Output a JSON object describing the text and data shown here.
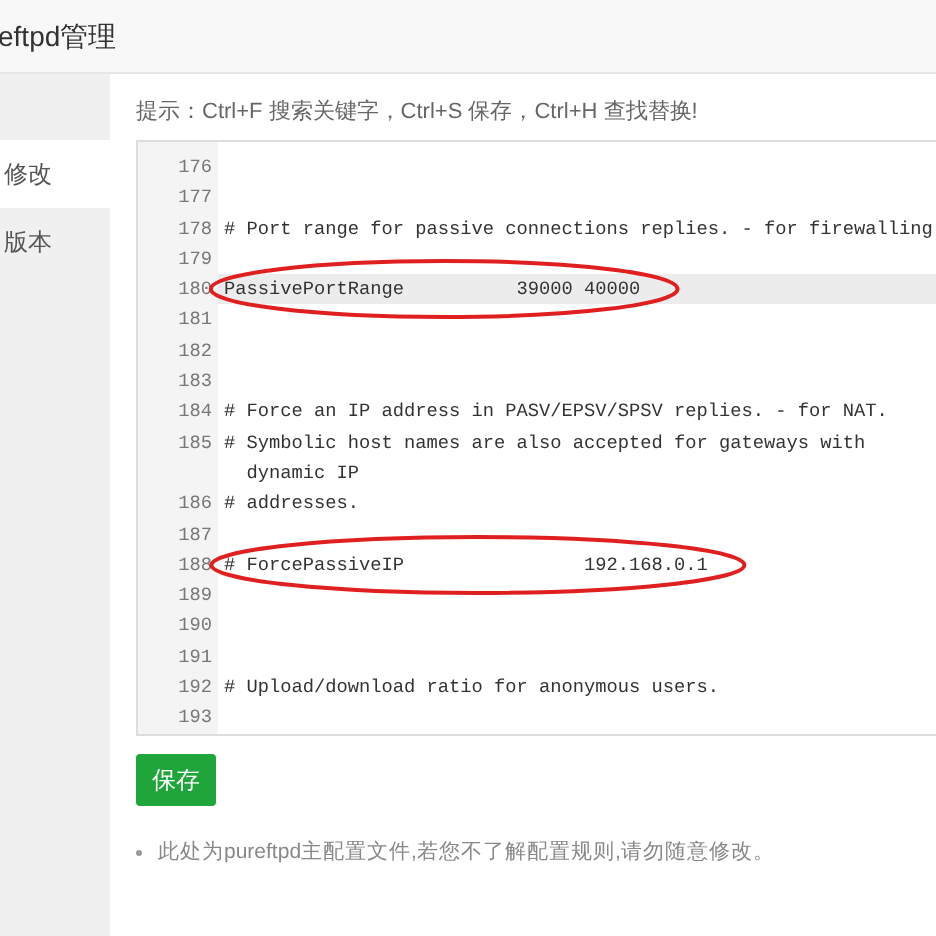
{
  "window": {
    "title": "eftpd管理"
  },
  "sidebar": {
    "items": [
      {
        "label": "修改",
        "selected": true
      },
      {
        "label": "版本",
        "selected": false
      }
    ]
  },
  "hint": "提示：Ctrl+F 搜索关键字，Ctrl+S 保存，Ctrl+H 查找替换!",
  "editor": {
    "lines": [
      {
        "number": "176",
        "active": false,
        "circled": false
      },
      {
        "number": "177",
        "active": false,
        "circled": false
      },
      {
        "number": "178",
        "text": "# Port range for passive connections replies. - for firewalling",
        "active": false,
        "circled": false
      },
      {
        "number": "179",
        "active": false,
        "circled": false
      },
      {
        "number": "180",
        "text": "PassivePortRange          39000 40000",
        "active": true,
        "circled": true
      },
      {
        "number": "181",
        "active": false,
        "circled": false
      },
      {
        "number": "182",
        "active": false,
        "circled": false
      },
      {
        "number": "183",
        "active": false,
        "circled": false
      },
      {
        "number": "184",
        "text": "# Force an IP address in PASV/EPSV/SPSV replies. - for NAT.",
        "active": false,
        "circled": false
      },
      {
        "number": "185",
        "text": "# Symbolic host names are also accepted for gateways with dynamic IP",
        "active": false,
        "circled": false
      },
      {
        "number": "186",
        "text": "# addresses.",
        "active": false,
        "circled": false
      },
      {
        "number": "187",
        "active": false,
        "circled": false
      },
      {
        "number": "188",
        "text": "# ForcePassiveIP                192.168.0.1",
        "active": false,
        "circled": true
      },
      {
        "number": "189",
        "active": false,
        "circled": false
      },
      {
        "number": "190",
        "active": false,
        "circled": false
      },
      {
        "number": "191",
        "active": false,
        "circled": false
      },
      {
        "number": "192",
        "text": "# Upload/download ratio for anonymous users.",
        "active": false,
        "circled": false
      },
      {
        "number": "193",
        "active": false,
        "circled": false
      }
    ]
  },
  "save_button": "保存",
  "notes": [
    "此处为pureftpd主配置文件,若您不了解配置规则,请勿随意修改。"
  ]
}
